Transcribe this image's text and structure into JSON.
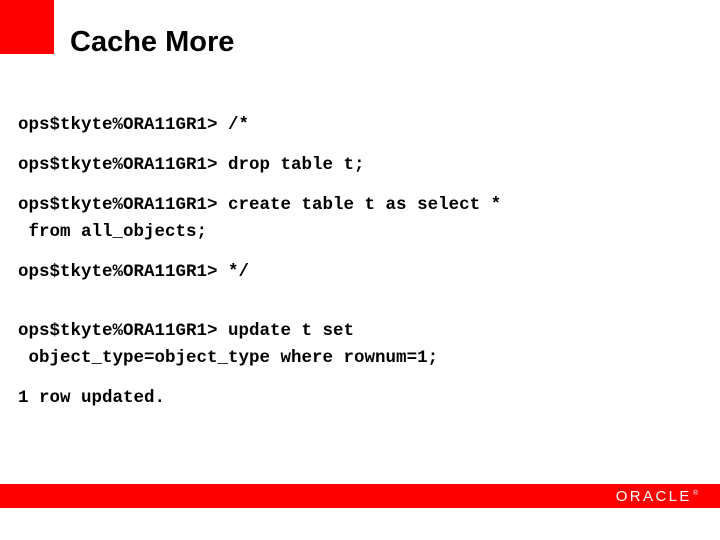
{
  "header": {
    "title": "Cache More",
    "accent_color": "#fe0000"
  },
  "console": {
    "prompt": "ops$tkyte%ORA11GR1>",
    "blocks": [
      {
        "id": "comment-open",
        "lines": [
          "ops$tkyte%ORA11GR1> /*"
        ]
      },
      {
        "id": "drop-table",
        "lines": [
          "ops$tkyte%ORA11GR1> drop table t;"
        ]
      },
      {
        "id": "create-table",
        "lines": [
          "ops$tkyte%ORA11GR1> create table t as select *",
          " from all_objects;"
        ]
      },
      {
        "id": "comment-close",
        "lines": [
          "ops$tkyte%ORA11GR1> */"
        ]
      },
      {
        "id": "update-statement",
        "lines": [
          "ops$tkyte%ORA11GR1> update t set",
          " object_type=object_type where rownum=1;"
        ]
      },
      {
        "id": "update-result",
        "lines": [
          "1 row updated."
        ]
      }
    ]
  },
  "footer": {
    "bar_color": "#fe0000",
    "logo_text": "ORACLE",
    "logo_trademark": "®"
  }
}
